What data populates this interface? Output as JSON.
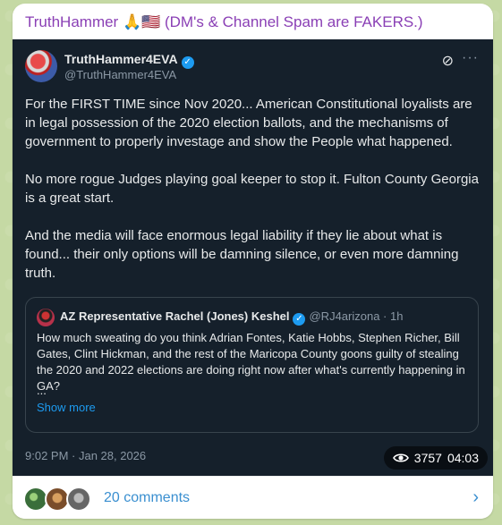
{
  "channel": {
    "title": "TruthHammer 🙏🇺🇸 (DM's & Channel Spam are FAKERS.)"
  },
  "tweet": {
    "author_name": "TruthHammer4EVA",
    "author_handle": "@TruthHammer4EVA",
    "paragraphs": [
      "For the FIRST TIME since Nov 2020... American Constitutional loyalists are in legal possession of the 2020 election ballots, and the mechanisms of government to properly investage and show the People what happened.",
      "No more rogue Judges playing goal keeper to stop it. Fulton County Georgia is a great start.",
      "And the media will face enormous legal liability if they lie about what is found... their only options will be damning silence, or even more damning truth."
    ],
    "timestamp": "9:02 PM · Jan 28, 2026",
    "quote": {
      "author_name": "AZ Representative Rachel (Jones) Keshel",
      "author_handle": "@RJ4arizona · 1h",
      "text": "How much sweating do you think Adrian Fontes, Katie Hobbs, Stephen Richer, Bill Gates, Clint Hickman, and the rest of the Maricopa County goons guilty of stealing the 2020  and 2022 elections are doing right now after what's currently happening in GA?",
      "ellipsis": "...",
      "show_more": "Show more"
    }
  },
  "stats": {
    "views": "3757",
    "time": "04:03"
  },
  "comments": {
    "label": "20 comments"
  },
  "colors": {
    "channel_title": "#8a3fb5",
    "tweet_bg": "#15202b",
    "link_blue": "#1d9bf0",
    "comments_blue": "#3a8fd0"
  },
  "icons": {
    "verified": "verified-badge-icon",
    "grok": "grok-icon",
    "more": "more-icon",
    "views": "eye-icon",
    "chevron": "chevron-right-icon"
  }
}
